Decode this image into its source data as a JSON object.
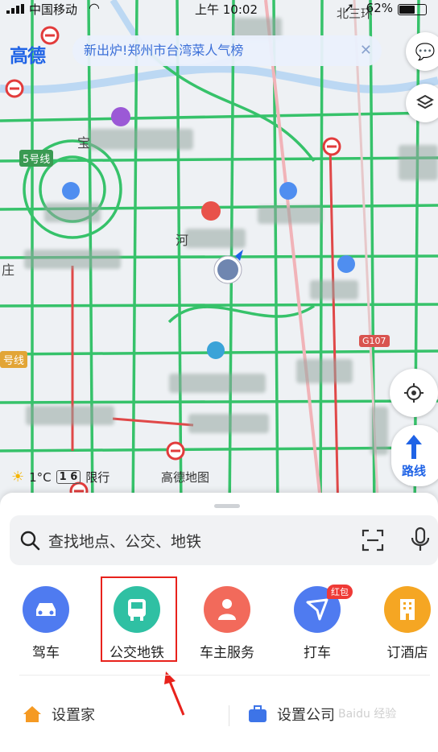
{
  "status_bar": {
    "carrier": "中国移动",
    "time": "上午 10:02",
    "battery_text": "62%",
    "battery_level": 0.62
  },
  "app": {
    "logo": "高德"
  },
  "notice": {
    "text": "新出炉!郑州市台湾菜人气榜",
    "close_icon": "close-icon"
  },
  "map": {
    "labels": {
      "line5": "5号线",
      "g107": "G107",
      "line_left": "号线",
      "place_a": "宝",
      "place_b": "河",
      "place_c": "庄",
      "place_d": "北三环"
    },
    "weather": {
      "temperature": "1°C",
      "restriction_plate": "1 6",
      "restriction_label": "限行"
    },
    "brand": "高德地图",
    "route_button": "路线"
  },
  "search": {
    "placeholder": "查找地点、公交、地铁"
  },
  "actions": [
    {
      "label": "驾车",
      "color": "#4f7bf0",
      "icon": "car-icon"
    },
    {
      "label": "公交地铁",
      "color": "#2fc0a3",
      "icon": "bus-icon"
    },
    {
      "label": "车主服务",
      "color": "#f26a5b",
      "icon": "driver-icon"
    },
    {
      "label": "打车",
      "color": "#4f7bf0",
      "icon": "taxi-icon"
    },
    {
      "label": "订酒店",
      "color": "#f5a623",
      "icon": "hotel-icon"
    }
  ],
  "taxi_badge": "红包",
  "places": {
    "home": "设置家",
    "work": "设置公司"
  },
  "watermark": "Baidu 经验"
}
